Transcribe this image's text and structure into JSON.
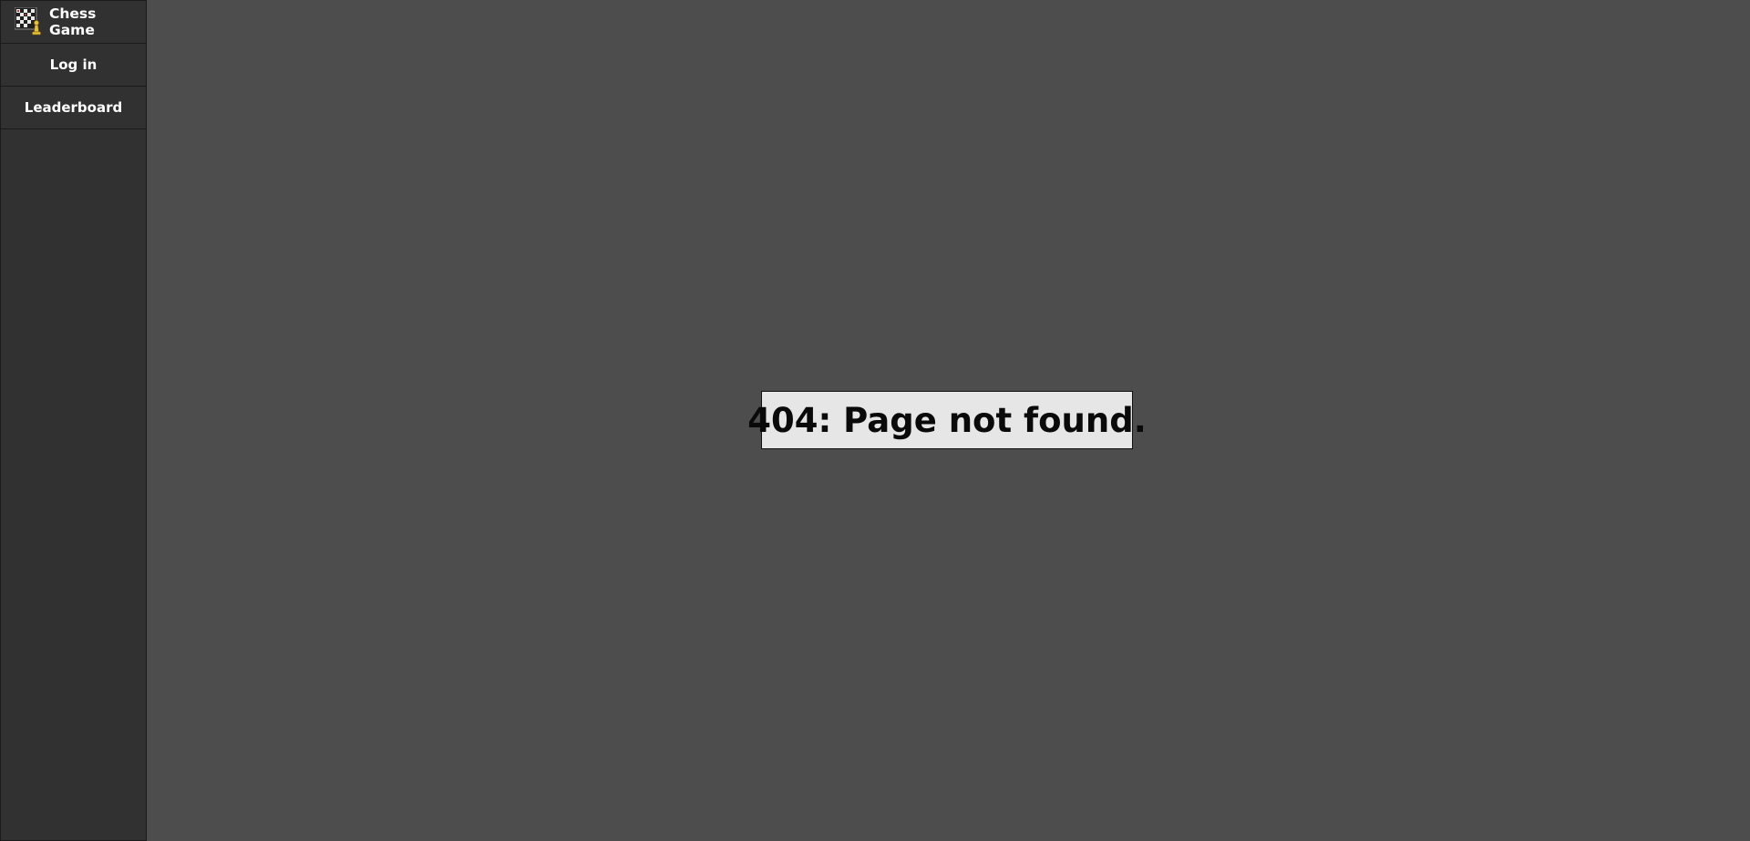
{
  "app": {
    "title": "Chess Game",
    "logo_icon": "chessboard-pawn-icon"
  },
  "sidebar": {
    "items": [
      {
        "label": "Log in"
      },
      {
        "label": "Leaderboard"
      }
    ]
  },
  "main": {
    "error_message": "404: Page not found."
  },
  "colors": {
    "background": "#4d4d4d",
    "sidebar": "#313131",
    "error_box": "#e6e6e6",
    "logo_accent": "#e8c13a"
  }
}
